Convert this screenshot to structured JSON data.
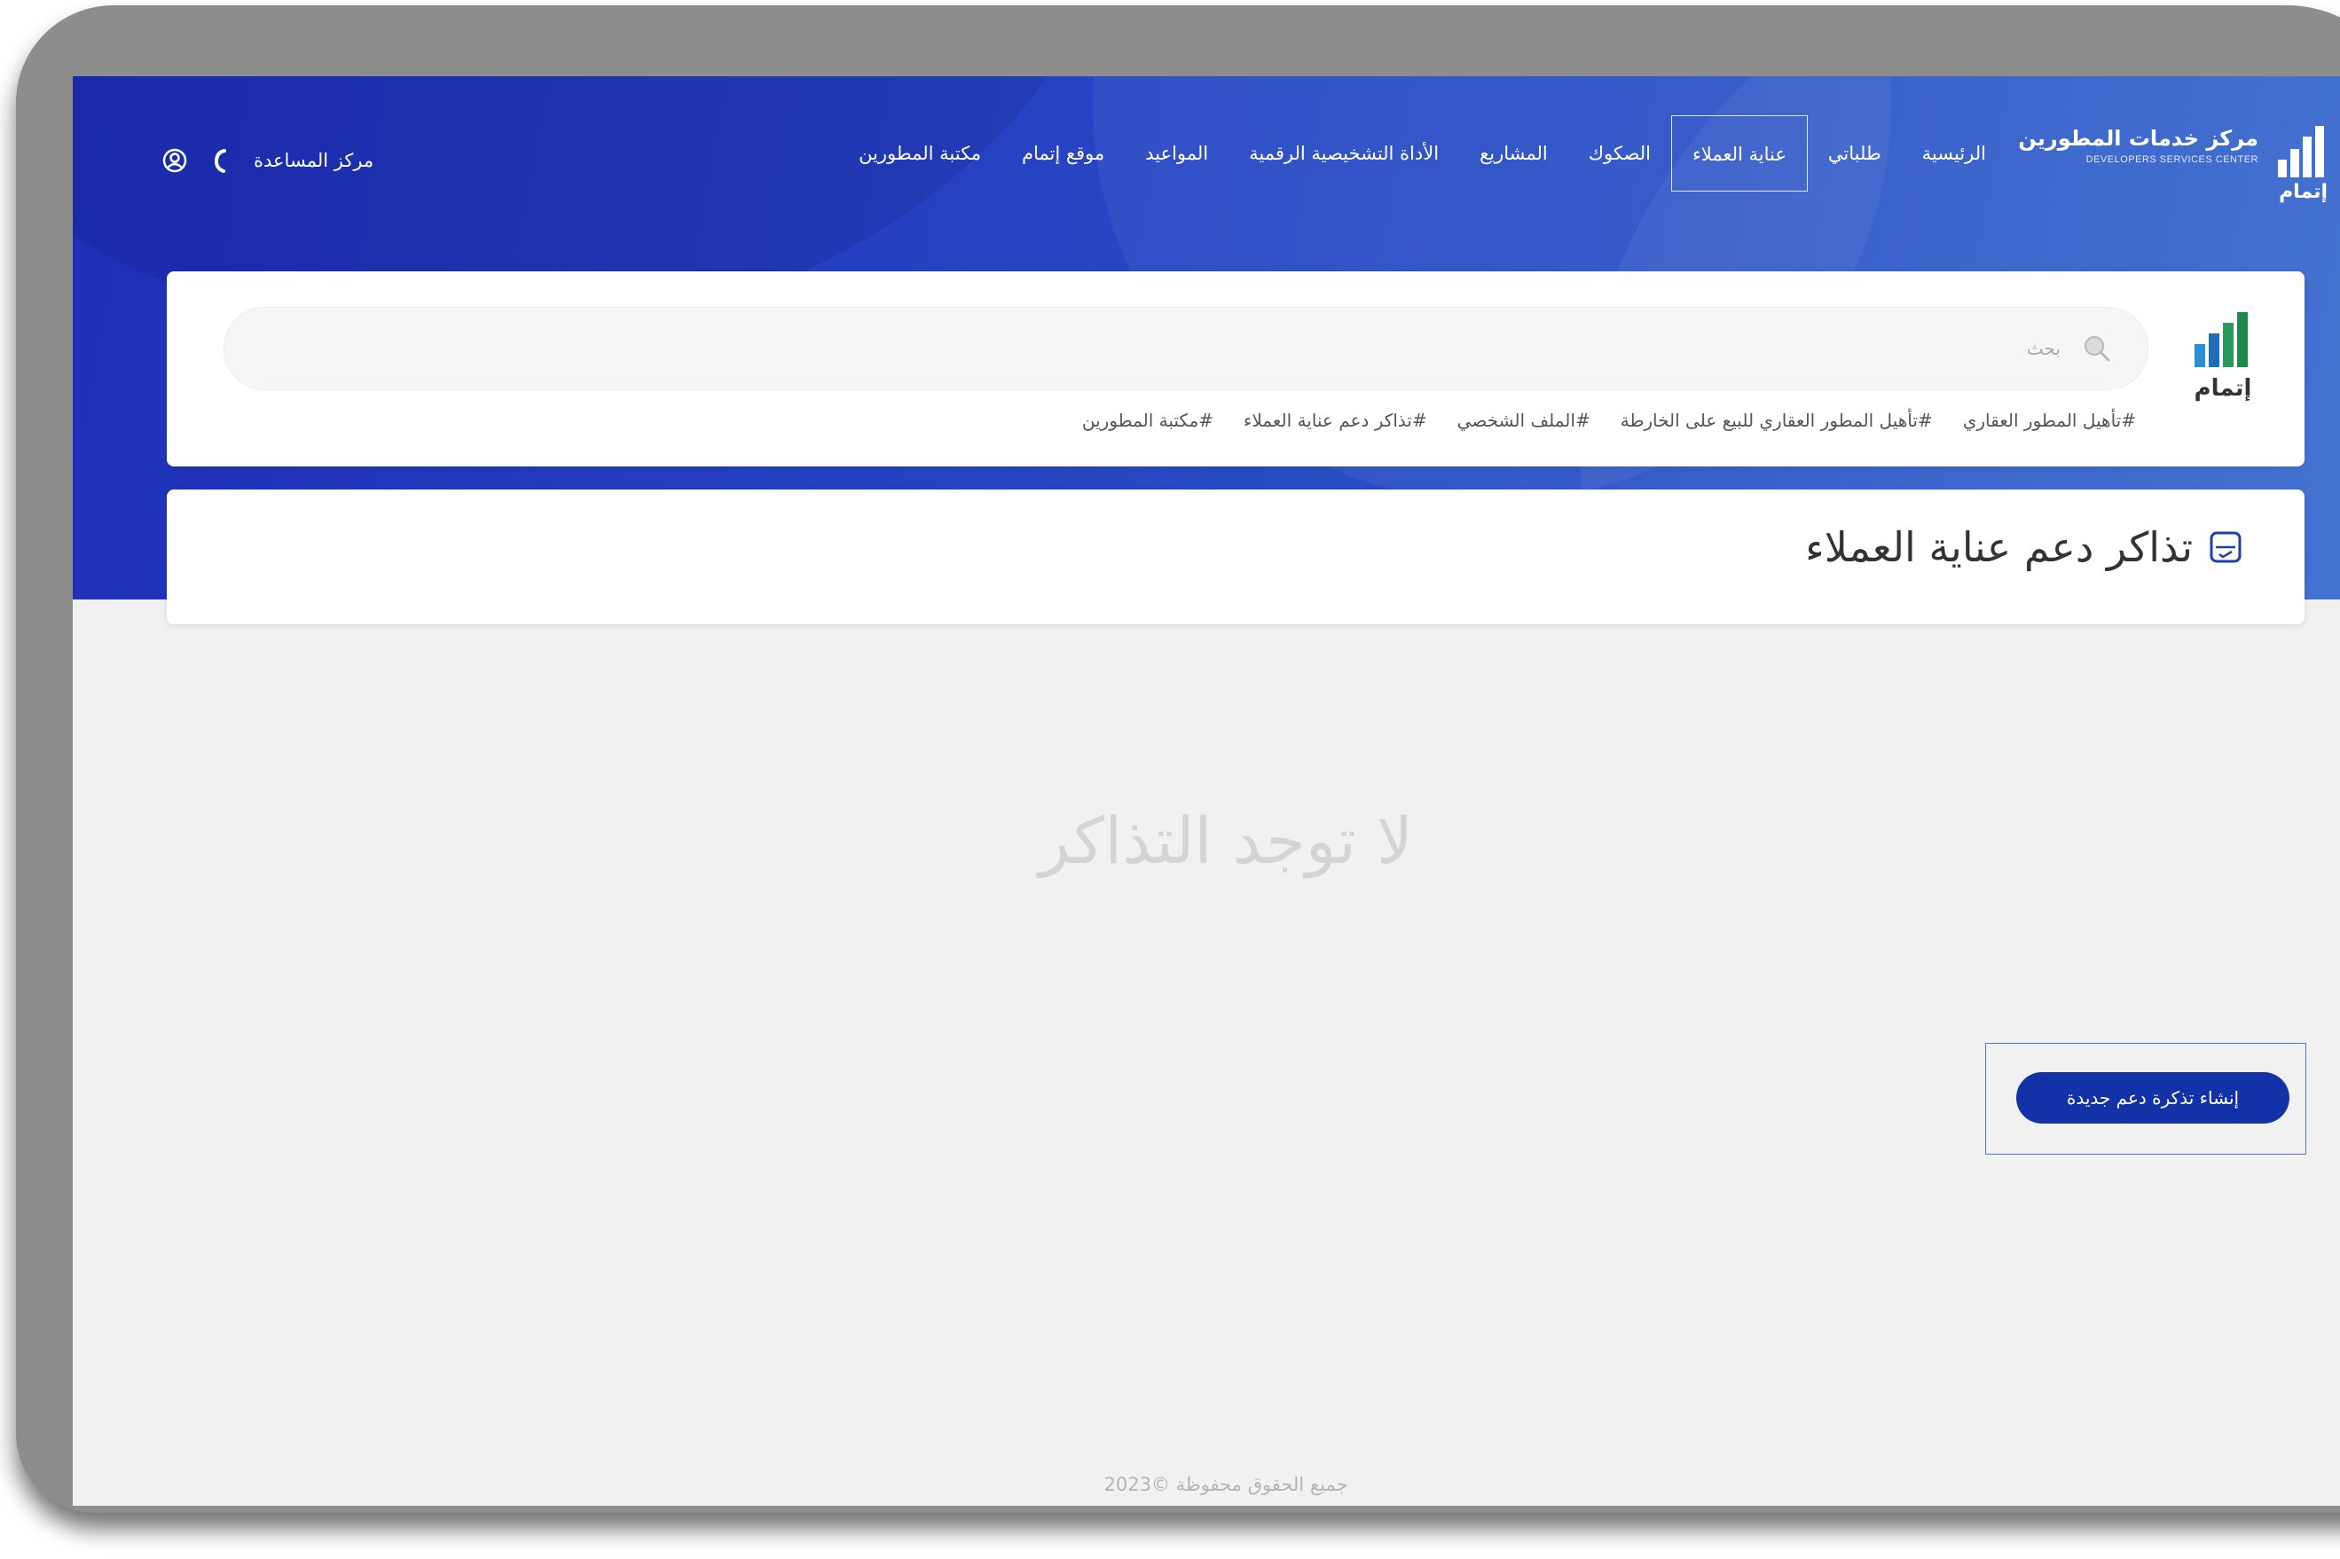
{
  "brand": {
    "title": "مركز خدمات المطورين",
    "subtitle": "DEVELOPERS SERVICES CENTER",
    "logo_text": "إتمام"
  },
  "nav": {
    "items": [
      {
        "label": "الرئيسية"
      },
      {
        "label": "طلباتي"
      },
      {
        "label": "عناية العملاء",
        "active": true
      },
      {
        "label": "الصكوك"
      },
      {
        "label": "المشاريع"
      },
      {
        "label": "الأداة التشخيصية الرقمية"
      },
      {
        "label": "المواعيد"
      },
      {
        "label": "موقع إتمام"
      },
      {
        "label": "مكتبة المطورين"
      }
    ]
  },
  "util": {
    "help_label": "مركز المساعدة",
    "icons": [
      "phone-icon",
      "user-circle-icon"
    ]
  },
  "search": {
    "placeholder": "بحث",
    "logo_text": "إتمام",
    "tags": [
      "#تأهيل المطور العقاري",
      "#تأهيل المطور العقاري للبيع على الخارطة",
      "#الملف الشخصي",
      "#تذاكر دعم عناية العملاء",
      "#مكتبة المطورين"
    ]
  },
  "page": {
    "title": "تذاكر دعم عناية العملاء",
    "empty_message": "لا توجد التذاكر",
    "new_ticket_label": "إنشاء تذكرة دعم جديدة"
  },
  "footer": {
    "copyright": "جميع الحقوق محفوظة ©2023"
  },
  "colors": {
    "hero_primary": "#1e2fb8",
    "hero_secondary": "#3b6dcf",
    "button": "#1432a8",
    "logo_green": "#1d8a4a",
    "logo_blue": "#2c8fd6"
  }
}
